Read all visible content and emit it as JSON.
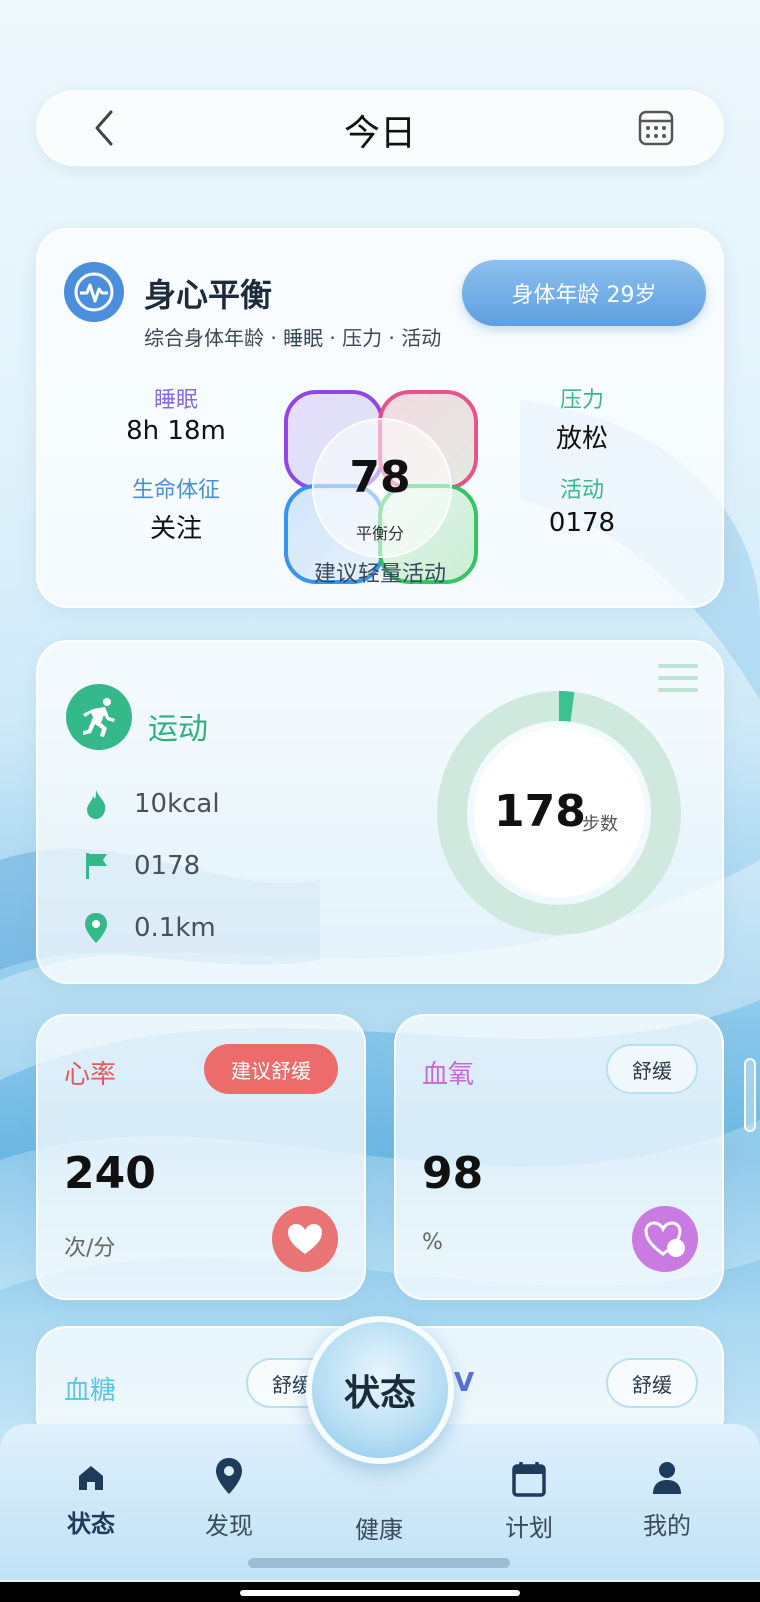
{
  "header": {
    "title": "今日"
  },
  "balance": {
    "title": "身心平衡",
    "subtitle": "综合身体年龄 · 睡眠 · 压力 · 活动",
    "age_button": "身体年龄 29岁",
    "sleep_label": "睡眠",
    "sleep_value": "8h 18m",
    "vitals_label": "生命体征",
    "vitals_value": "关注",
    "stress_label": "压力",
    "stress_value": "放松",
    "activity_label": "活动",
    "activity_value": "0178",
    "score": "78",
    "score_label": "平衡分",
    "suggestion": "建议轻量活动"
  },
  "sport": {
    "title": "运动",
    "calories": "10kcal",
    "steps_flag": "0178",
    "distance": "0.1km",
    "ring_value": "178",
    "ring_unit": "步数",
    "ring_progress": 0.02
  },
  "heart": {
    "title": "心率",
    "pill": "建议舒缓",
    "value": "240",
    "unit": "次/分"
  },
  "oxygen": {
    "title": "血氧",
    "pill": "舒缓",
    "value": "98",
    "unit": "%"
  },
  "sugar": {
    "title": "血糖",
    "pill": "舒缓"
  },
  "hrv": {
    "title": "V",
    "pill": "舒缓"
  },
  "center_button": "状态",
  "nav": {
    "status": "状态",
    "discover": "发现",
    "health": "健康",
    "plan": "计划",
    "mine": "我的"
  },
  "colors": {
    "accent_blue": "#4b8fdc",
    "sport_green": "#36b98a",
    "heart_red": "#e96a6a",
    "oxygen_purple": "#c77be0",
    "sugar_cyan": "#5cc6e6"
  }
}
